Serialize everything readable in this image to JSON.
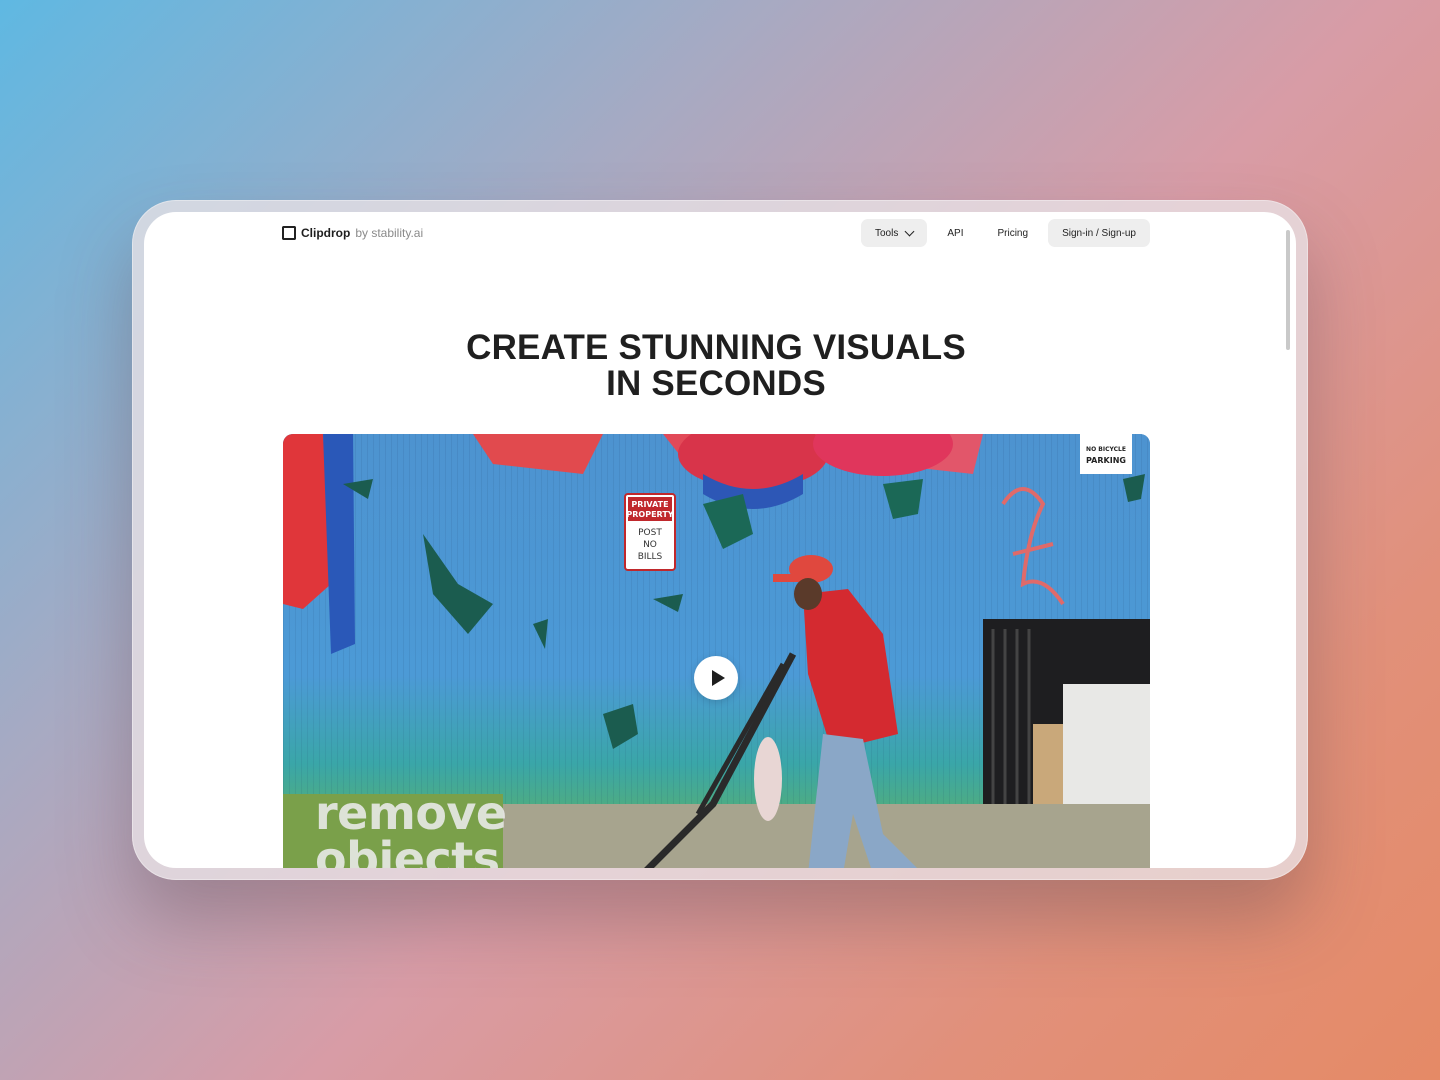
{
  "brand": {
    "name": "Clipdrop",
    "sub": "by stability.ai"
  },
  "nav": {
    "tools_label": "Tools",
    "api_label": "API",
    "pricing_label": "Pricing",
    "signin_label": "Sign-in / Sign-up"
  },
  "hero": {
    "line1": "CREATE STUNNING VISUALS",
    "line2": "IN SECONDS"
  },
  "video": {
    "overlay_line1": "remove",
    "overlay_line2": "objects",
    "sign_private_1": "PRIVATE",
    "sign_private_2": "PROPERTY",
    "sign_post_1": "POST",
    "sign_post_2": "NO",
    "sign_post_3": "BILLS",
    "sign_bicycle_1": "NO BICYCLE",
    "sign_bicycle_2": "PARKING"
  },
  "colors": {
    "background_start": "#5fb8e2",
    "background_end": "#e58a66",
    "title": "#1f1f1f",
    "pill_bg": "#eeeeee"
  },
  "icons": {
    "logo": "clipdrop-bracket-logo",
    "tools_chevron": "chevron-down-icon",
    "play": "play-icon"
  }
}
